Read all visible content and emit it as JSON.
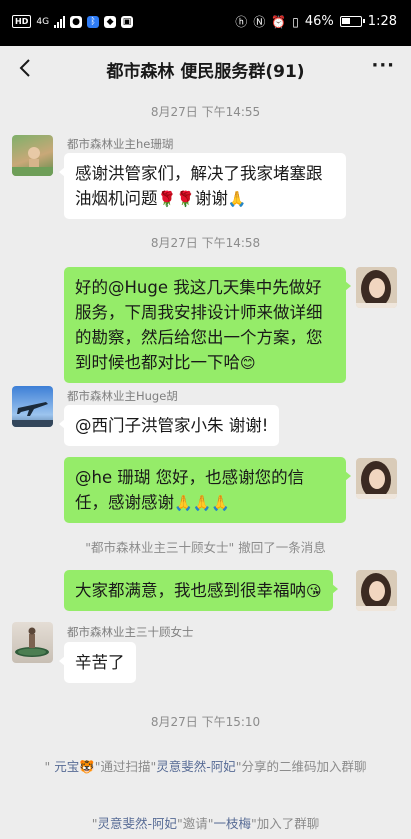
{
  "status_bar": {
    "hd_badge": "HD",
    "network": "4G",
    "left_icons": [
      "chat-bubble-icon",
      "bluetooth-ble-icon",
      "shield-icon",
      "shopping-cart-icon"
    ],
    "right_icons": [
      "hd-call-icon",
      "nfc-icon",
      "alarm-icon",
      "vibrate-icon",
      "battery-icon"
    ],
    "battery_percent": "46%",
    "battery_level": 0.46,
    "time": "1:28"
  },
  "nav": {
    "title": "都市森林 便民服务群(91)",
    "back_icon": "chevron-left-icon",
    "more_label": "···"
  },
  "messages": [
    {
      "type": "timestamp",
      "text": "8月27日 下午14:55"
    },
    {
      "type": "in",
      "sender": "都市森林业主he珊瑚",
      "text": "感谢洪管家们，解决了我家堵塞跟油烟机问题",
      "emoji_after": "🌹🌹",
      "text_tail": "谢谢",
      "emoji_tail": "🙏"
    },
    {
      "type": "timestamp",
      "text": "8月27日 下午14:58"
    },
    {
      "type": "out",
      "text": "好的@Huge  我这几天集中先做好服务，下周我安排设计师来做详细的勘察，然后给您出一个方案，您到时候也都对比一下哈",
      "emoji_tail": "😊"
    },
    {
      "type": "in",
      "sender": "都市森林业主Huge胡",
      "text": "@西门子洪管家小朱  谢谢!"
    },
    {
      "type": "out",
      "text": "@he 珊瑚  您好，也感谢您的信任，感谢感谢",
      "emoji_tail": "🙏🙏🙏"
    },
    {
      "type": "recall",
      "text": "\"都市森林业主三十顾女士\" 撤回了一条消息"
    },
    {
      "type": "out",
      "text": "大家都满意，我也感到很幸福呐",
      "emoji_tail": "😘"
    },
    {
      "type": "in",
      "sender": "都市森林业主三十顾女士",
      "text": "辛苦了"
    },
    {
      "type": "timestamp",
      "text": "8月27日 下午15:10"
    },
    {
      "type": "system",
      "q1": "\" ",
      "name1": "元宝",
      "emoji": "🐯",
      "q2": "\"通过扫描\"",
      "name2": "灵意斐然-阿妃",
      "tail": "\"分享的二维码加入群聊"
    },
    {
      "type": "system",
      "q1": "\"",
      "name1": "灵意斐然-阿妃",
      "q2": "\"邀请\"",
      "name2": "一枝梅",
      "tail": "\"加入了群聊"
    }
  ]
}
